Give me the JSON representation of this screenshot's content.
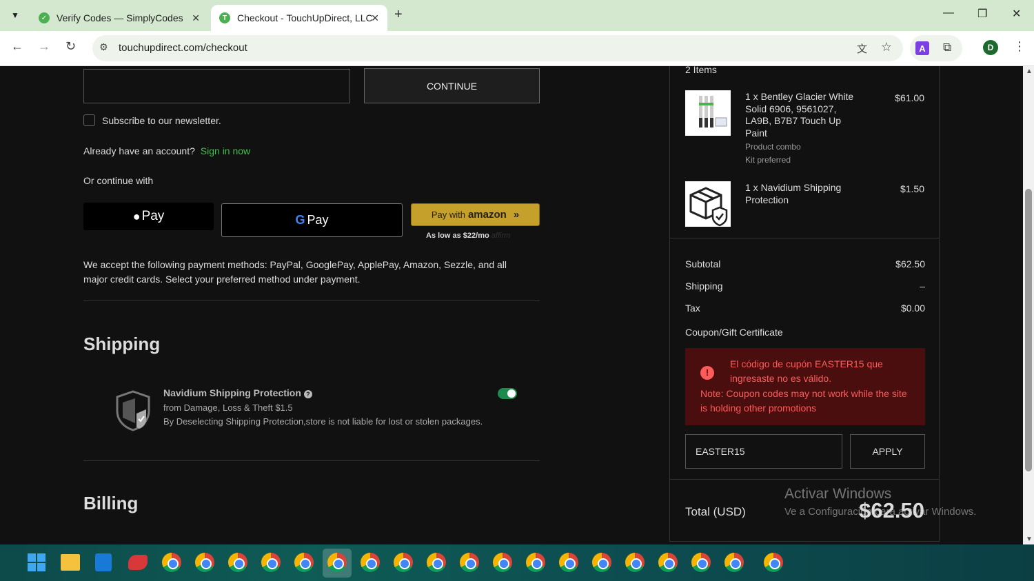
{
  "browser": {
    "tabs": [
      {
        "title": "Verify Codes — SimplyCodes",
        "active": false
      },
      {
        "title": "Checkout - TouchUpDirect, LLC",
        "active": true
      }
    ],
    "url": "touchupdirect.com/checkout",
    "profile_initial": "D",
    "extension_label": "A"
  },
  "checkout": {
    "continue_label": "CONTINUE",
    "newsletter_label": "Subscribe to our newsletter.",
    "account_prompt": "Already have an account?",
    "signin_link": "Sign in now",
    "or_continue": "Or continue with",
    "applepay_label": "Pay",
    "gpay_label": "Pay",
    "amazon_prefix": "Pay with",
    "amazon_brand": "amazon",
    "affirm_text": "As low as $22/mo",
    "affirm_logo": "affirm",
    "accept_text": "We accept the following payment methods: PayPal, GooglePay, ApplePay, Amazon, Sezzle, and all major credit cards. Select your preferred method under payment.",
    "shipping_heading": "Shipping",
    "protection": {
      "title": "Navidium Shipping Protection",
      "subtitle": "from Damage, Loss & Theft $1.5",
      "note": "By Deselecting Shipping Protection,store is not liable for lost or stolen packages.",
      "enabled": true
    },
    "billing_heading": "Billing"
  },
  "summary": {
    "items_count": "2 Items",
    "items": [
      {
        "name": "1 x Bentley Glacier White Solid 6906, 9561027, LA9B, B7B7 Touch Up Paint",
        "meta1": "Product combo",
        "meta2": "Kit preferred",
        "price": "$61.00"
      },
      {
        "name": "1 x Navidium Shipping Protection",
        "price": "$1.50"
      }
    ],
    "subtotal_label": "Subtotal",
    "subtotal": "$62.50",
    "shipping_label": "Shipping",
    "shipping": "–",
    "tax_label": "Tax",
    "tax": "$0.00",
    "coupon_label": "Coupon/Gift Certificate",
    "coupon_error": "El código de cupón EASTER15 que ingresaste no es válido.",
    "coupon_note": "Note: Coupon codes may not work while the site is holding other promotions",
    "coupon_value": "EASTER15",
    "apply_label": "APPLY",
    "total_label": "Total (USD)",
    "total": "$62.50"
  },
  "watermark": {
    "line1": "Activar Windows",
    "line2": "Ve a Configuración para activar Windows."
  },
  "colors": {
    "accent_green": "#3cc24a",
    "error_bg": "#4a0e0e",
    "error_text": "#ff5b5b",
    "toggle_on": "#1e8a4e"
  }
}
